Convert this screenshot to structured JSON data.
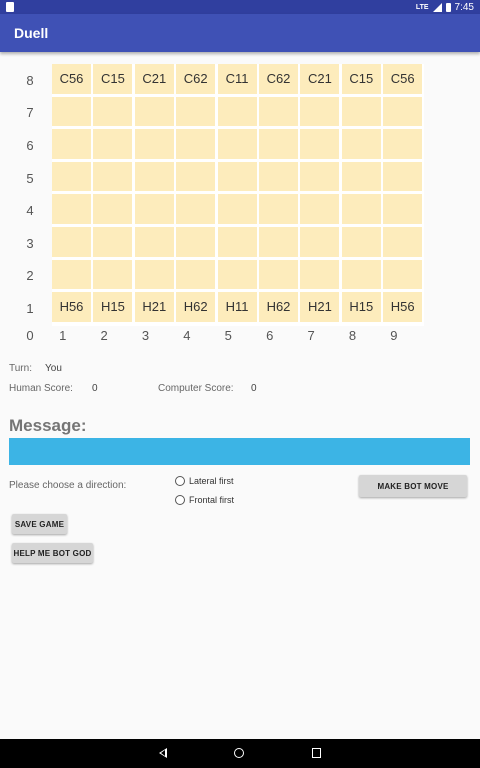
{
  "app": {
    "title": "Duell"
  },
  "status_bar": {
    "time": "7:45",
    "network": "LTE"
  },
  "board": {
    "row_labels": [
      "8",
      "7",
      "6",
      "5",
      "4",
      "3",
      "2",
      "1"
    ],
    "col_labels": [
      "0",
      "1",
      "2",
      "3",
      "4",
      "5",
      "6",
      "7",
      "8",
      "9"
    ],
    "rows": [
      [
        "C56",
        "C15",
        "C21",
        "C62",
        "C11",
        "C62",
        "C21",
        "C15",
        "C56"
      ],
      [
        "",
        "",
        "",
        "",
        "",
        "",
        "",
        "",
        ""
      ],
      [
        "",
        "",
        "",
        "",
        "",
        "",
        "",
        "",
        ""
      ],
      [
        "",
        "",
        "",
        "",
        "",
        "",
        "",
        "",
        ""
      ],
      [
        "",
        "",
        "",
        "",
        "",
        "",
        "",
        "",
        ""
      ],
      [
        "",
        "",
        "",
        "",
        "",
        "",
        "",
        "",
        ""
      ],
      [
        "",
        "",
        "",
        "",
        "",
        "",
        "",
        "",
        ""
      ],
      [
        "H56",
        "H15",
        "H21",
        "H62",
        "H11",
        "H62",
        "H21",
        "H15",
        "H56"
      ]
    ]
  },
  "turn": {
    "label": "Turn:",
    "value": "You"
  },
  "scores": {
    "human_label": "Human Score:",
    "human_value": "0",
    "computer_label": "Computer Score:",
    "computer_value": "0"
  },
  "message": {
    "title": "Message:",
    "text": ""
  },
  "direction": {
    "prompt": "Please choose a direction:",
    "options": [
      "Lateral first",
      "Frontal first"
    ]
  },
  "buttons": {
    "make_bot_move": "MAKE BOT MOVE",
    "save_game": "SAVE GAME",
    "help": "HELP ME BOT GOD"
  },
  "colors": {
    "cell": "#fdecbc",
    "message_bar": "#3cb4e5",
    "app_bar": "#3f51b5"
  }
}
